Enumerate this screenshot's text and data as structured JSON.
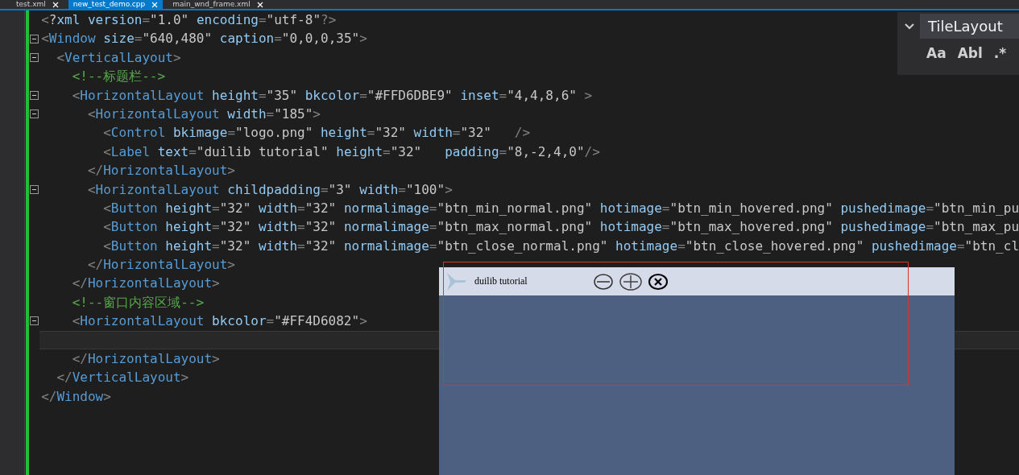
{
  "tabs": [
    {
      "label": "test.xml",
      "selected": false
    },
    {
      "label": "new_test_demo.cpp",
      "selected": true
    },
    {
      "label": "main_wnd_frame.xml",
      "selected": false
    }
  ],
  "editor": {
    "lines": [
      {
        "text": "<?xml version=\"1.0\" encoding=\"utf-8\"?>",
        "fold": false,
        "current": false
      },
      {
        "text": "<Window size=\"640,480\" caption=\"0,0,0,35\">",
        "fold": true,
        "current": false
      },
      {
        "text": "  <VerticalLayout>",
        "fold": true,
        "current": false
      },
      {
        "text": "    <!--标题栏-->",
        "fold": false,
        "current": false
      },
      {
        "text": "    <HorizontalLayout height=\"35\" bkcolor=\"#FFD6DBE9\" inset=\"4,4,8,6\" >",
        "fold": true,
        "current": false
      },
      {
        "text": "      <HorizontalLayout width=\"185\">",
        "fold": true,
        "current": false
      },
      {
        "text": "        <Control bkimage=\"logo.png\" height=\"32\" width=\"32\"   />",
        "fold": false,
        "current": false
      },
      {
        "text": "        <Label text=\"duilib tutorial\" height=\"32\"   padding=\"8,-2,4,0\"/>",
        "fold": false,
        "current": false
      },
      {
        "text": "      </HorizontalLayout>",
        "fold": false,
        "current": false
      },
      {
        "text": "      <HorizontalLayout childpadding=\"3\" width=\"100\">",
        "fold": true,
        "current": false
      },
      {
        "text": "        <Button height=\"32\" width=\"32\" normalimage=\"btn_min_normal.png\" hotimage=\"btn_min_hovered.png\" pushedimage=\"btn_min_pu",
        "fold": false,
        "current": false
      },
      {
        "text": "        <Button height=\"32\" width=\"32\" normalimage=\"btn_max_normal.png\" hotimage=\"btn_max_hovered.png\" pushedimage=\"btn_max_pu",
        "fold": false,
        "current": false
      },
      {
        "text": "        <Button height=\"32\" width=\"32\" normalimage=\"btn_close_normal.png\" hotimage=\"btn_close_hovered.png\" pushedimage=\"btn_cl",
        "fold": false,
        "current": false
      },
      {
        "text": "      </HorizontalLayout>",
        "fold": false,
        "current": false
      },
      {
        "text": "    </HorizontalLayout>",
        "fold": false,
        "current": false
      },
      {
        "text": "    <!--窗口内容区域-->",
        "fold": false,
        "current": false
      },
      {
        "text": "    <HorizontalLayout bkcolor=\"#FF4D6082\">",
        "fold": true,
        "current": false
      },
      {
        "fold": false,
        "current": true
      },
      {
        "text": "    </HorizontalLayout>",
        "fold": false,
        "current": false
      },
      {
        "text": "  </VerticalLayout>",
        "fold": false,
        "current": false
      },
      {
        "text": "</Window>",
        "fold": false,
        "current": false
      }
    ]
  },
  "find_panel": {
    "value": "TileLayout",
    "options": [
      "Aa",
      "Abl",
      ".*"
    ]
  },
  "preview": {
    "title": "duilib tutorial"
  }
}
